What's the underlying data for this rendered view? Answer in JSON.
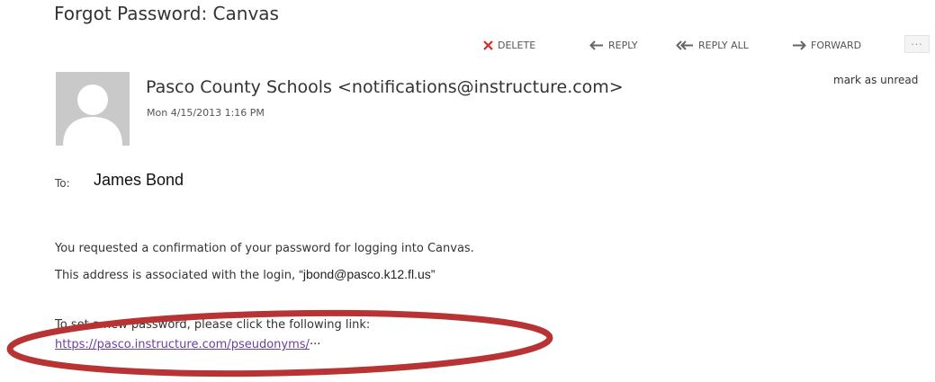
{
  "email": {
    "subject": "Forgot Password: Canvas",
    "sender": "Pasco County Schools <notifications@instructure.com>",
    "date": "Mon 4/15/2013 1:16 PM",
    "to_label": "To:",
    "to_value": "James Bond",
    "mark_unread": "mark as unread",
    "body": {
      "line1": "You requested a confirmation of your password for logging into Canvas.",
      "line2_prefix": "This address is associated with the login, ",
      "line2_login": "“jbond@pasco.k12.fl.us”",
      "line3": "To set a new password, please click the following link:",
      "link_text": "https://pasco.instructure.com/pseudonyms/",
      "link_ellipsis": "···"
    }
  },
  "toolbar": {
    "delete_label": "DELETE",
    "reply_label": "REPLY",
    "reply_all_label": "REPLY ALL",
    "forward_label": "FORWARD",
    "more_label": "···"
  },
  "colors": {
    "delete_icon": "#d92b2b",
    "link": "#6a3fa3",
    "annotation_ellipse": "#b83434",
    "avatar_bg": "#c9c9c9"
  },
  "icons": {
    "delete": "close-x-icon",
    "reply": "arrow-left-icon",
    "reply_all": "double-arrow-left-icon",
    "forward": "arrow-right-icon",
    "more": "ellipsis-icon",
    "avatar": "person-silhouette-icon"
  }
}
